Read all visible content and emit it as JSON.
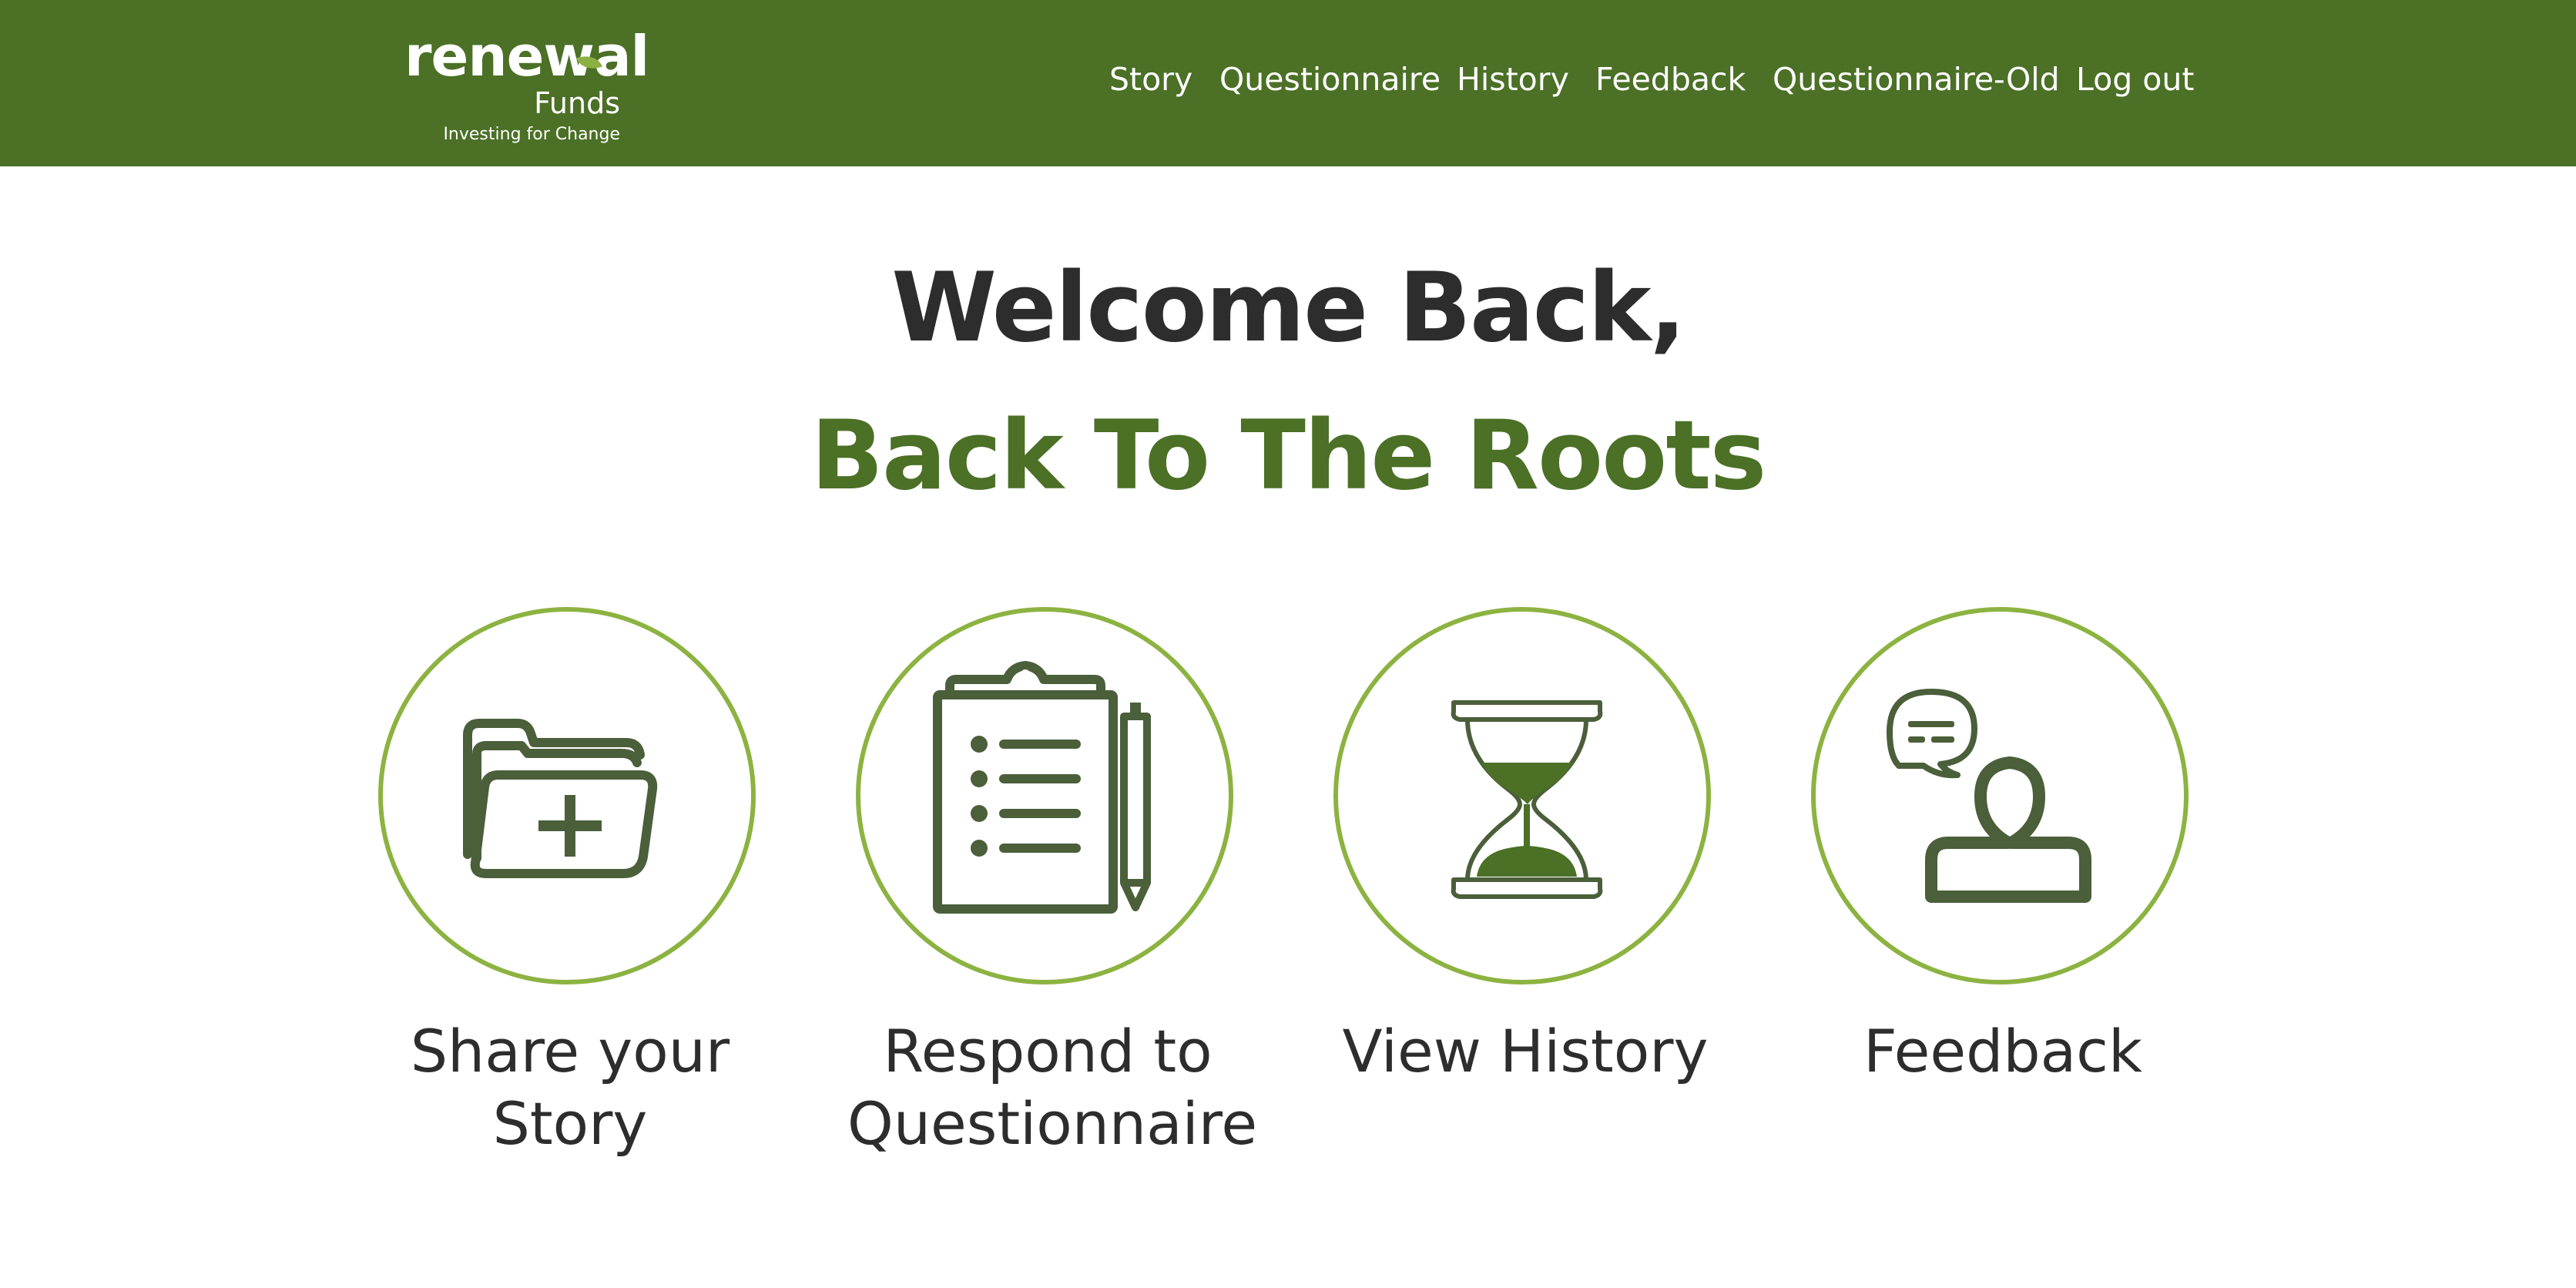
{
  "brand": {
    "name": "renewal",
    "sub": "Funds",
    "tagline": "Investing for Change"
  },
  "nav": [
    "Story",
    "Questionnaire",
    "History",
    "Feedback",
    "Questionnaire-Old",
    "Log out"
  ],
  "welcome": {
    "greeting": "Welcome Back,",
    "organization": "Back To The Roots"
  },
  "cards": [
    {
      "label": "Share your Story",
      "icon": "folder-plus-icon"
    },
    {
      "label": "Respond to Questionnaire",
      "icon": "clipboard-checklist-icon"
    },
    {
      "label": "View History",
      "icon": "hourglass-icon"
    },
    {
      "label": "Feedback",
      "icon": "user-speech-bubble-icon"
    }
  ],
  "colors": {
    "header_bg": "#4b7026",
    "accent": "#8cb341",
    "icon": "#4a5f3a",
    "text": "#2d2d2d"
  }
}
